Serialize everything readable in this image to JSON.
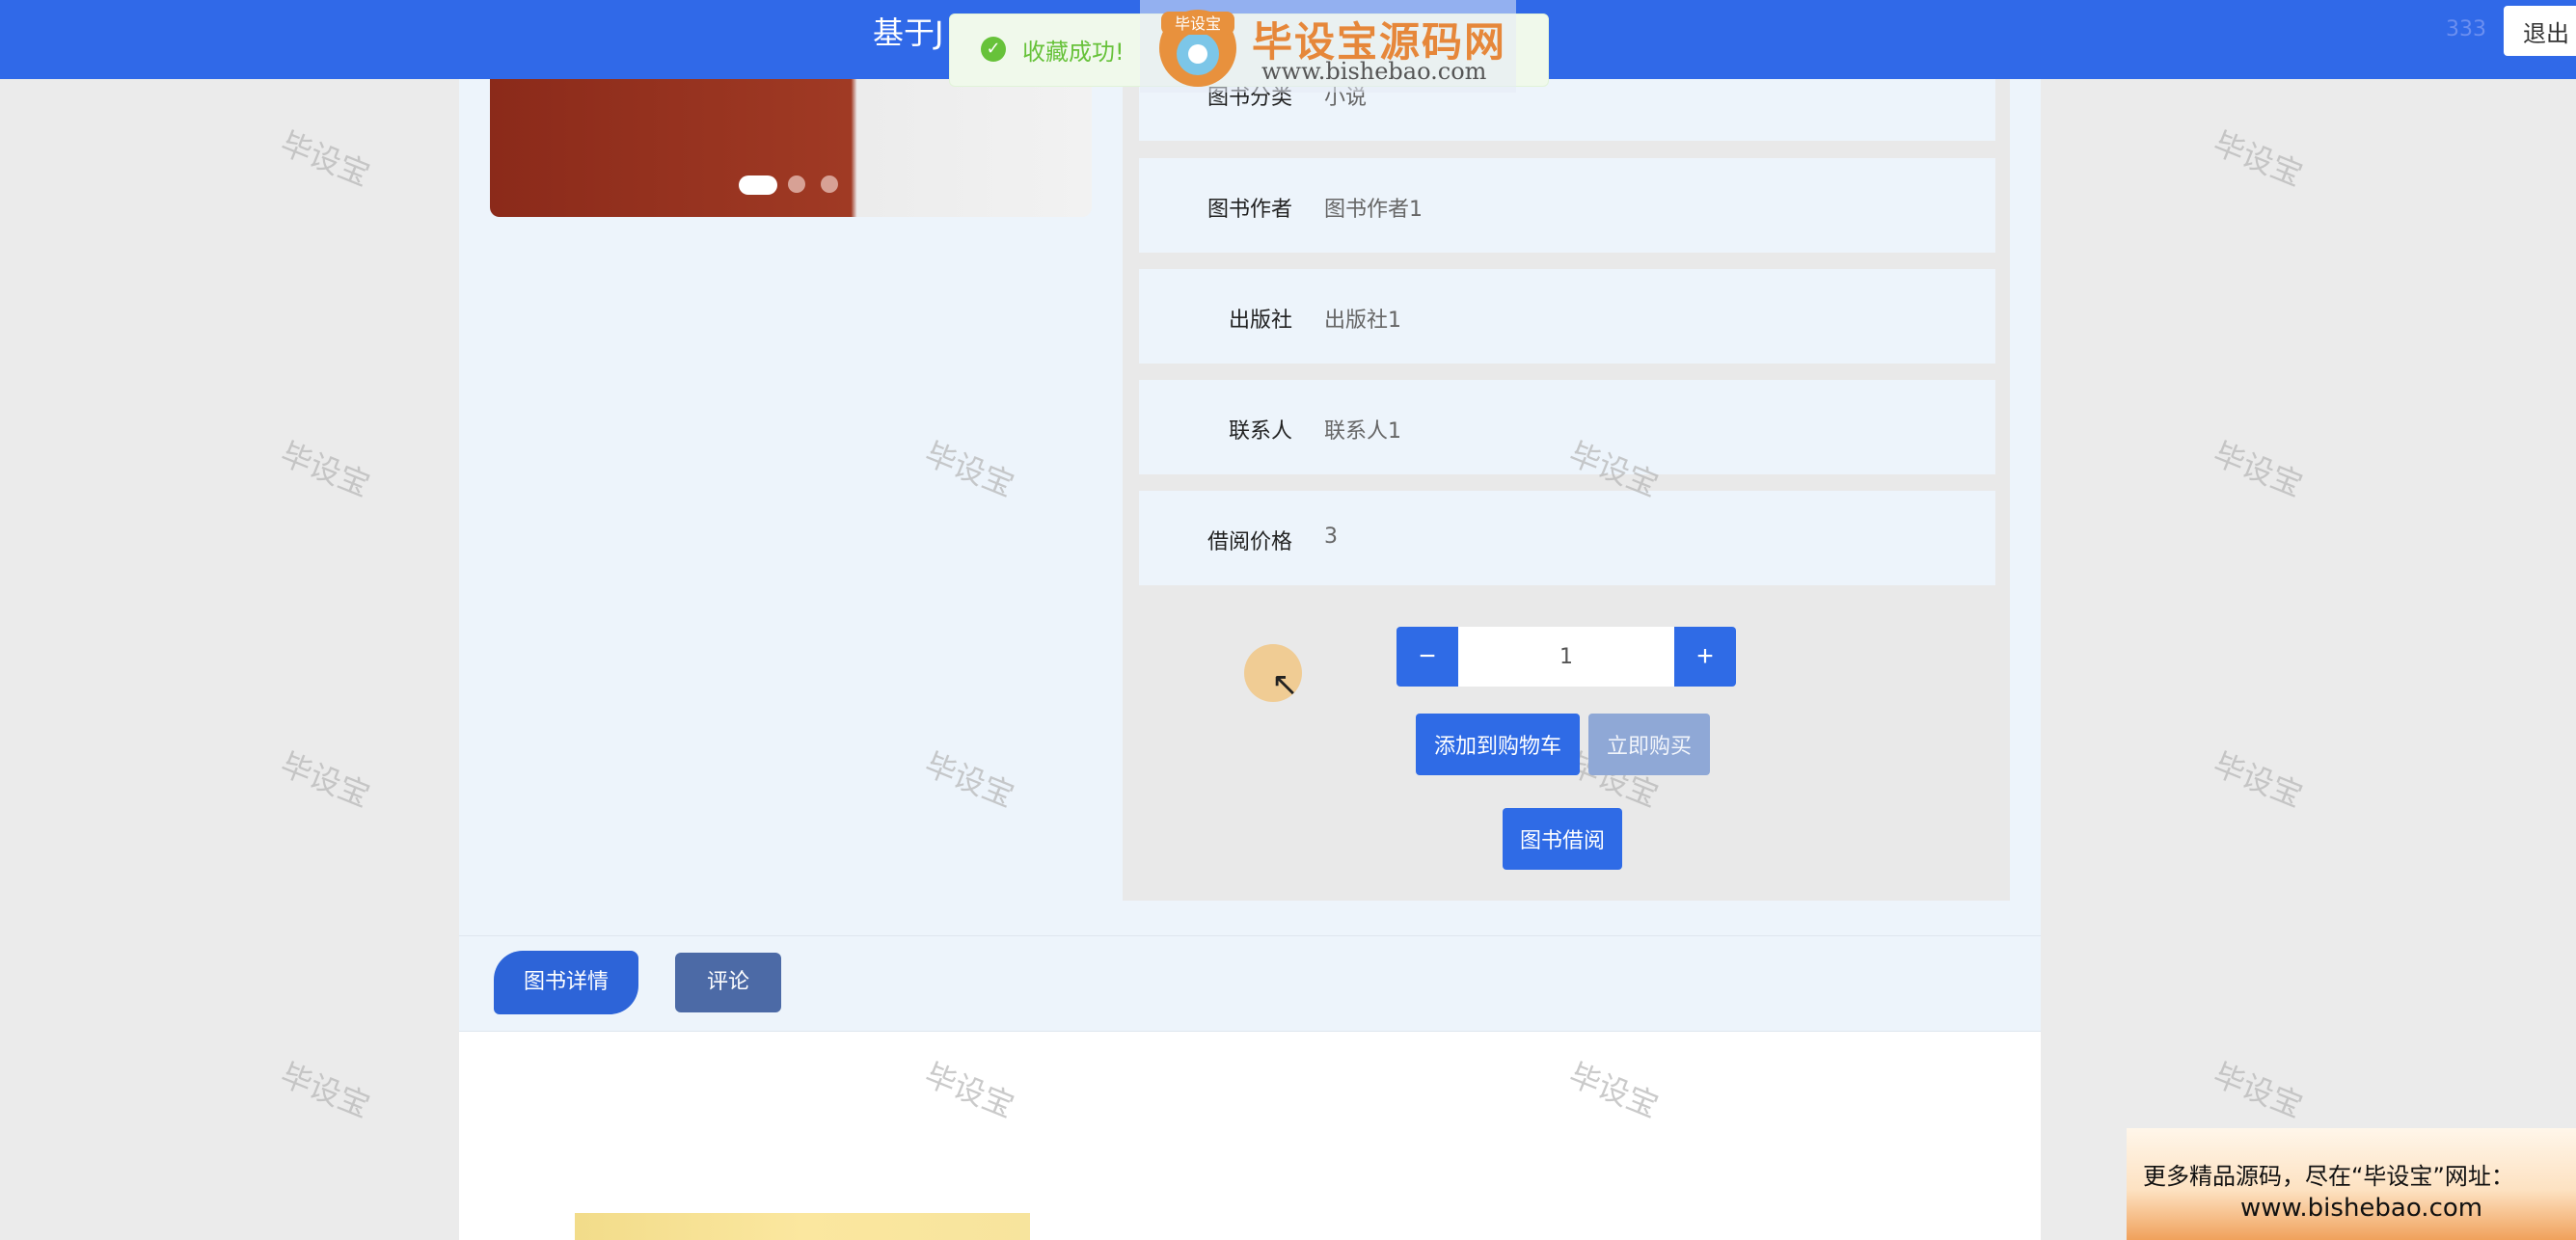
{
  "header": {
    "title": "基于J",
    "user_text": "333",
    "logout_label": "退出"
  },
  "toast": {
    "icon": "check-circle-icon",
    "message": "收藏成功!"
  },
  "watermark_logo": {
    "badge": "毕设宝",
    "title": "毕设宝源码网",
    "url": "www.bishebao.com"
  },
  "product": {
    "info_rows": [
      {
        "label": "图书分类",
        "value": "小说"
      },
      {
        "label": "图书作者",
        "value": "图书作者1"
      },
      {
        "label": "出版社",
        "value": "出版社1"
      },
      {
        "label": "联系人",
        "value": "联系人1"
      },
      {
        "label": "借阅价格",
        "value": "3"
      }
    ],
    "quantity": "1",
    "minus_label": "−",
    "plus_label": "+",
    "add_to_cart_label": "添加到购物车",
    "buy_now_label": "立即购买",
    "borrow_label": "图书借阅"
  },
  "tabs": [
    {
      "label": "图书详情"
    },
    {
      "label": "评论"
    }
  ],
  "watermark_text": "毕设宝",
  "ad": {
    "line1": "更多精品源码，尽在“毕设宝”网址：",
    "line2": "www.bishebao.com"
  },
  "colors": {
    "primary": "#3069e8",
    "success": "#67c23a",
    "panel_bg": "#edf4fb"
  }
}
